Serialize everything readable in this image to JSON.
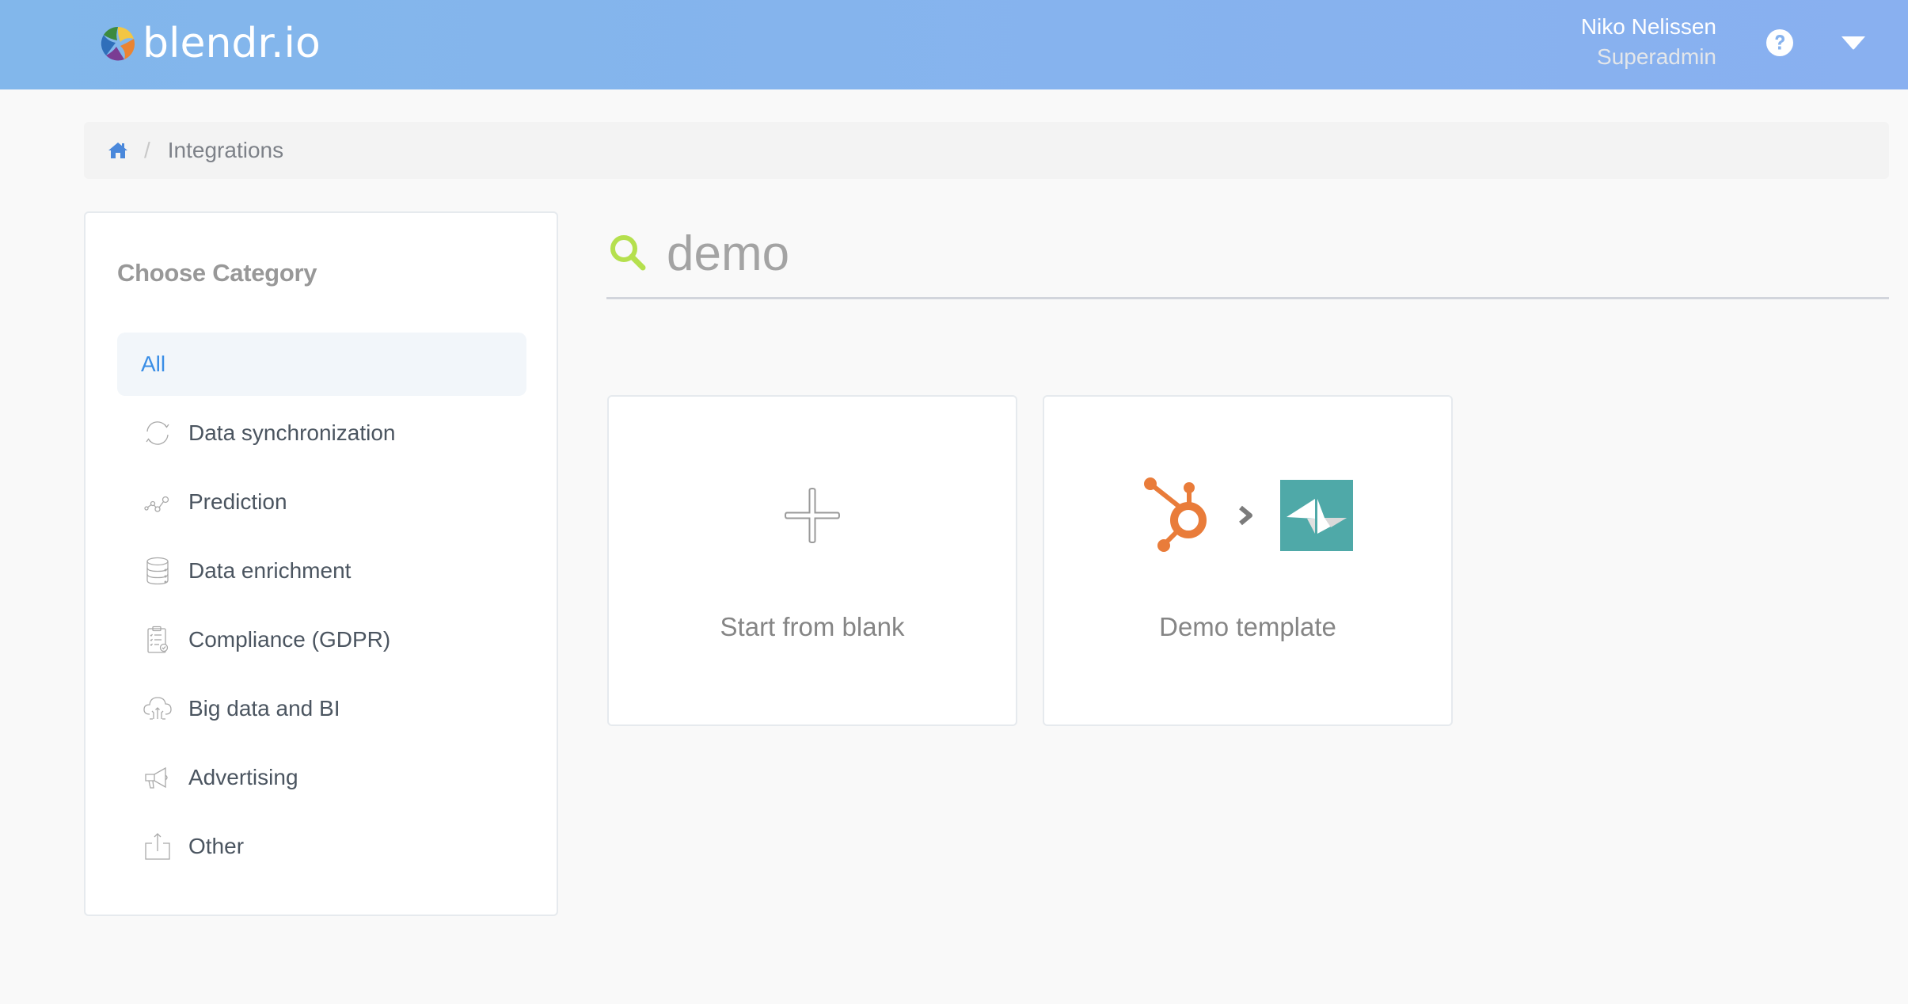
{
  "header": {
    "brand": "blendr.io",
    "user_name": "Niko Nelissen",
    "user_role": "Superadmin",
    "icons": [
      "blendr-logo-icon",
      "help-icon",
      "caret-down-icon"
    ]
  },
  "breadcrumb": {
    "home_icon": "home-icon",
    "separator": "/",
    "current": "Integrations"
  },
  "sidebar": {
    "title": "Choose Category",
    "items": [
      {
        "label": "All",
        "icon": "",
        "active": true
      },
      {
        "label": "Data synchronization",
        "icon": "sync-icon",
        "active": false
      },
      {
        "label": "Prediction",
        "icon": "prediction-graph-icon",
        "active": false
      },
      {
        "label": "Data enrichment",
        "icon": "database-icon",
        "active": false
      },
      {
        "label": "Compliance (GDPR)",
        "icon": "clipboard-check-icon",
        "active": false
      },
      {
        "label": "Big data and BI",
        "icon": "cloud-upload-icon",
        "active": false
      },
      {
        "label": "Advertising",
        "icon": "megaphone-icon",
        "active": false
      },
      {
        "label": "Other",
        "icon": "share-upload-icon",
        "active": false
      }
    ]
  },
  "search": {
    "value": "demo",
    "icon": "search-icon"
  },
  "cards": [
    {
      "label": "Start from blank",
      "icon": "plus-icon"
    },
    {
      "label": "Demo template",
      "icons": [
        "hubspot-icon",
        "chevron-right-icon",
        "teamleader-icon"
      ]
    }
  ],
  "colors": {
    "header": "#87b3ee",
    "accent_blue": "#3a8ee6",
    "search_green": "#b5e04e",
    "hubspot_orange": "#e97c3a",
    "teal": "#4fa9a8"
  }
}
